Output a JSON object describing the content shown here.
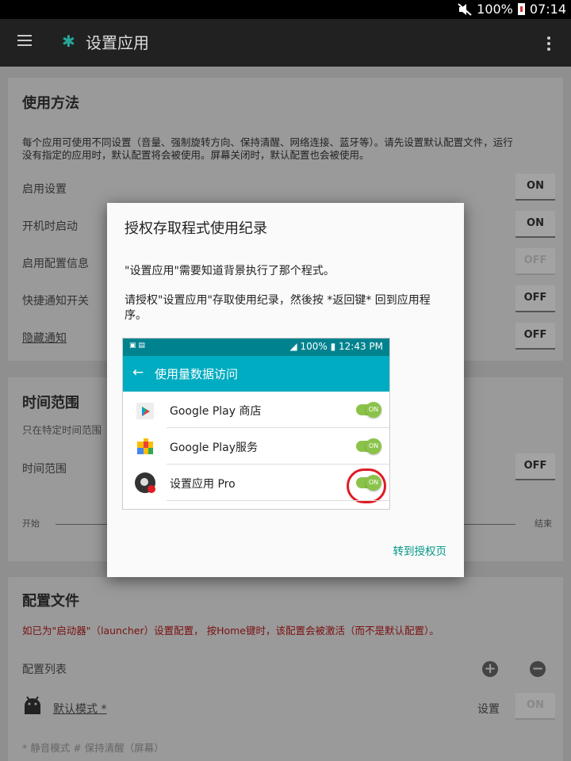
{
  "status_bar": {
    "battery": "100%",
    "time": "07:14"
  },
  "app_bar": {
    "title": "设置应用"
  },
  "usage_card": {
    "title": "使用方法",
    "desc_line1": "每个应用可使用不同设置（音量、强制旋转方向、保持清醒、网络连接、蓝牙等）。请先设置默认配置文件，运行",
    "desc_line2": "没有指定的应用时，默认配置将会被使用。屏幕关闭时，默认配置也会被使用。",
    "rows": [
      {
        "label": "启用设置",
        "toggle": "ON"
      },
      {
        "label": "开机时启动",
        "toggle": "ON"
      },
      {
        "label": "启用配置信息",
        "toggle": "OFF"
      },
      {
        "label": "快捷通知开关",
        "toggle": "OFF"
      },
      {
        "label": "隐藏通知",
        "toggle": "OFF"
      }
    ]
  },
  "time_card": {
    "title": "时间范围",
    "desc": "只在特定时间范围",
    "row_label": "时间范围",
    "toggle": "OFF",
    "start_label": "开始",
    "end_label": "结束"
  },
  "profile_card": {
    "title": "配置文件",
    "warning": "如已为\"启动器\"（launcher）设置配置， 按Home键时，该配置会被激活（而不是默认配置）。",
    "list_label": "配置列表",
    "default_profile": "默认模式 *",
    "settings_label": "设置",
    "toggle": "ON",
    "footer": "* 静音模式    # 保持清醒（屏幕）"
  },
  "dialog": {
    "title": "授权存取程式使用纪录",
    "para1": "\"设置应用\"需要知道背景执行了那个程式。",
    "para2": "请授权\"设置应用\"存取使用纪录，然後按 *返回键* 回到应用程序。",
    "button": "转到授权页",
    "screenshot": {
      "battery": "100%",
      "time": "12:43 PM",
      "title": "使用量数据访问",
      "apps": [
        {
          "name": "Google Play 商店",
          "switch": "ON"
        },
        {
          "name": "Google Play服务",
          "switch": "ON"
        },
        {
          "name": "设置应用 Pro",
          "switch": "ON"
        }
      ]
    }
  }
}
